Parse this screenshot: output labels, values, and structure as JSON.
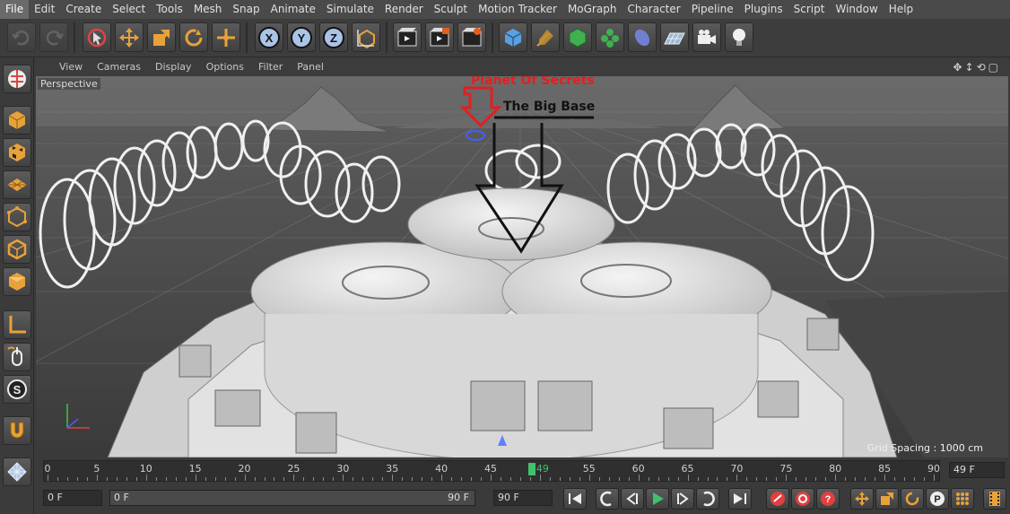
{
  "menubar": {
    "items": [
      "File",
      "Edit",
      "Create",
      "Select",
      "Tools",
      "Mesh",
      "Snap",
      "Animate",
      "Simulate",
      "Render",
      "Sculpt",
      "Motion Tracker",
      "MoGraph",
      "Character",
      "Pipeline",
      "Plugins",
      "Script",
      "Window",
      "Help"
    ]
  },
  "viewport": {
    "menu": [
      "View",
      "Cameras",
      "Display",
      "Options",
      "Filter",
      "Panel"
    ],
    "label": "Perspective",
    "grid_spacing": "Grid Spacing : 1000 cm",
    "annotations": {
      "planet": "Planet Of Secrets",
      "base": "The Big Base"
    }
  },
  "timeline": {
    "ticks": [
      "0",
      "5",
      "10",
      "15",
      "20",
      "25",
      "30",
      "35",
      "40",
      "45",
      "49",
      "55",
      "60",
      "65",
      "70",
      "75",
      "80",
      "85",
      "90"
    ],
    "current_frame": 49,
    "current_label": "49",
    "max_frame": 90,
    "frame_field": "49 F"
  },
  "transport": {
    "start_field": "0 F",
    "range_start": "0 F",
    "range_end": "90 F",
    "end_field": "90 F"
  },
  "colors": {
    "accent": "#3ec26a",
    "annotation_red": "#e02020",
    "selected_orange": "#e8a23a"
  },
  "icons": {
    "toolbar": [
      "undo-icon",
      "redo-icon",
      "live-selection-icon",
      "move-icon",
      "scale-icon",
      "rotate-icon",
      "multi-tool-icon",
      "x-axis-icon",
      "y-axis-icon",
      "z-axis-icon",
      "coordinate-system-icon",
      "render-view-icon",
      "render-picture-viewer-icon",
      "render-settings-icon",
      "cube-icon",
      "pen-icon",
      "subdivision-icon",
      "cloner-icon",
      "deformer-icon",
      "floor-icon",
      "camera-icon",
      "light-icon"
    ],
    "left": [
      "viewport-icon",
      "model-mode-icon",
      "texture-mode-icon",
      "workplane-icon",
      "points-mode-icon",
      "edges-mode-icon",
      "polygons-mode-icon",
      "axis-icon",
      "tweak-icon",
      "snap-icon",
      "magnet-icon",
      "grid-icon"
    ]
  }
}
